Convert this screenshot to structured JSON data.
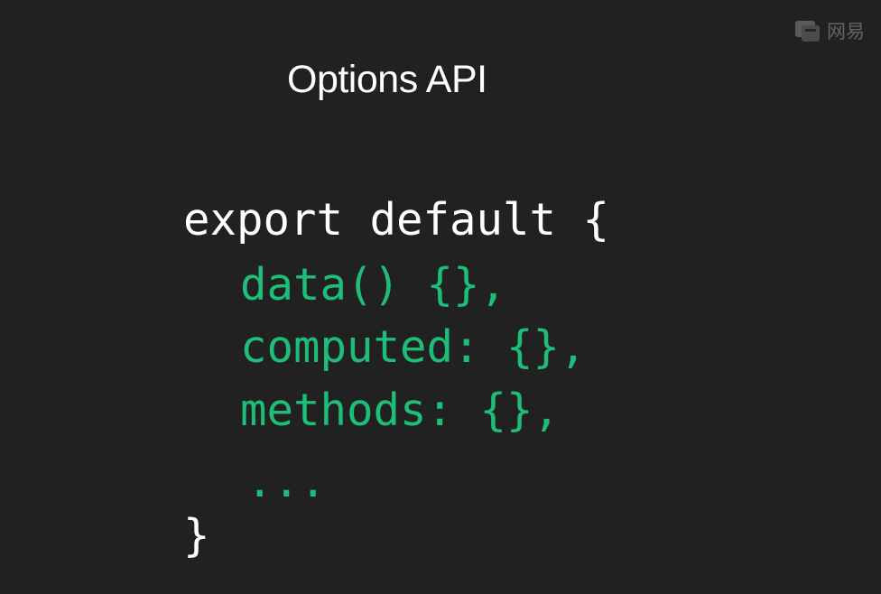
{
  "slide": {
    "title": "Options API",
    "watermark": {
      "icon": "video-logo-icon",
      "text": "网易"
    }
  },
  "code": {
    "open": "export default {",
    "members": [
      "data() {},",
      "computed: {},",
      "methods: {},"
    ],
    "ellipsis": "...",
    "close": "}"
  },
  "colors": {
    "background": "#212121",
    "text": "#ffffff",
    "accent": "#1dbf78"
  }
}
